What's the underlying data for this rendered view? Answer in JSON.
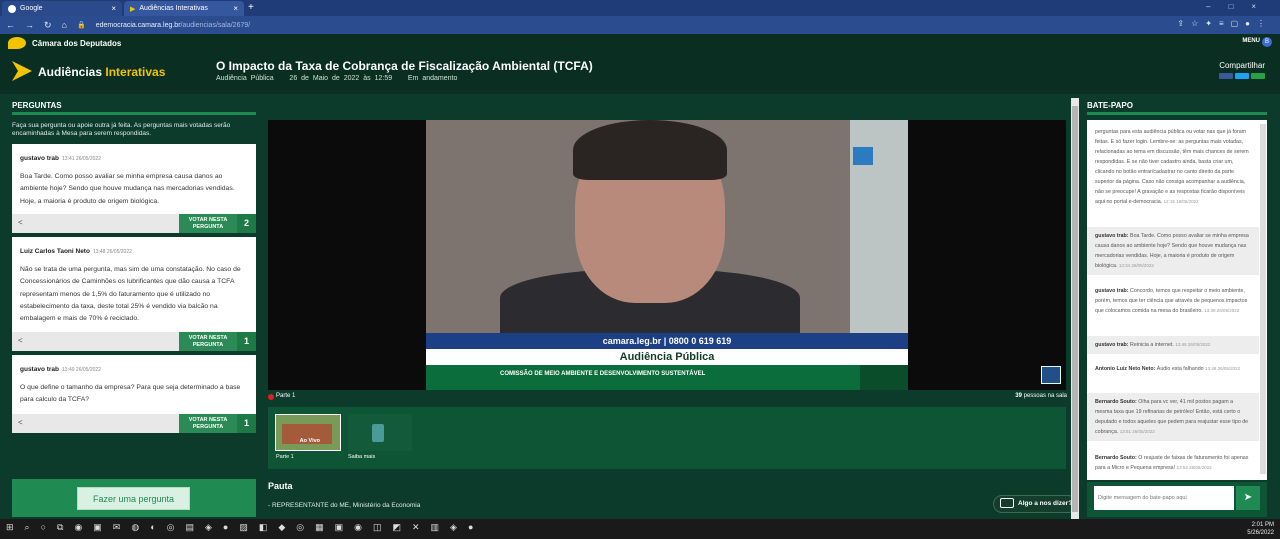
{
  "browser": {
    "tabs": [
      {
        "label": "Google"
      },
      {
        "label": "Audiências Interativas"
      }
    ],
    "url_host": "edemocracia.camara.leg.br",
    "url_path": "/audiencias/sala/2679/"
  },
  "camara": {
    "name": "Câmara dos Deputados",
    "menu": "MENU",
    "avatar_letter": "B"
  },
  "header": {
    "logo_white": "Audiências ",
    "logo_yellow": "Interativas",
    "title": "O Impacto da Taxa de Cobrança de Fiscalização Ambiental (TCFA)",
    "subtitle": "Audiência Pública    26 de Maio de 2022 às 12:59    Em andamento",
    "share": "Compartilhar"
  },
  "questions": {
    "heading": "PERGUNTAS",
    "intro": "Faça sua pergunta ou apoie outra já feita. As perguntas mais votadas serão encaminhadas à Mesa para serem respondidas.",
    "vote_label": "VOTAR NESTA PERGUNTA",
    "items": [
      {
        "author": "gustavo trab",
        "time": "13:41 26/05/2022",
        "text": "Boa Tarde. Como posso avaliar se minha empresa causa danos ao ambiente hoje? Sendo que houve mudança nas mercadorias vendidas. Hoje, a maioria é produto de origem biológica.",
        "votes": "2"
      },
      {
        "author": "Luiz Carlos Taoni Neto",
        "time": "13:48 26/05/2022",
        "text": "Não se trata de uma pergunta, mas sim de uma constatação. No caso de Concessionários de Caminhões os lubrificantes que dão causa a TCFA representam menos de 1,5% do faturamento que é utilizado no estabelecimento da taxa, deste total 25% é vendido via balcão na embalagem e mais de 70% é reciclado.",
        "votes": "1"
      },
      {
        "author": "gustavo trab",
        "time": "13:49 26/05/2022",
        "text": "O que define o tamanho da empresa? Para que seja determinado a base para calculo da TCFA?",
        "votes": "1"
      }
    ],
    "ask_button": "Fazer uma pergunta"
  },
  "video": {
    "banner_url": "camara.leg.br | 0800 0 619 619",
    "banner_title": "Audiência Pública",
    "banner_commission": "COMISSÃO DE MEIO AMBIENTE E DESENVOLVIMENTO SUSTENTÁVEL",
    "part_label": "Parte 1",
    "people_count": "39",
    "people_label": " pessoas na sala"
  },
  "thumbs": [
    {
      "label": "Parte 1",
      "badge": "Ao Vivo"
    },
    {
      "label": "Saiba mais"
    }
  ],
  "pauta": {
    "heading": "Pauta",
    "item": "- REPRESENTANTE do ME, Ministério da Economia"
  },
  "algo": "Algo a nos dizer?",
  "chat": {
    "heading": "BATE-PAPO",
    "messages": [
      {
        "author": "",
        "text": "perguntas para esta audiência pública ou votar nas que já foram feitas. E só fazer login. Lembre-se: as perguntas mais votadas, relacionadas ao tema em discussão, têm mais chances de serem respondidas. E se não tiver cadastro ainda, basta criar um, clicando no botão entrar/cadastrar no canto direito da parte superior da página. Caso não consiga acompanhar a audiência, não se preocupe! A gravação e as respostas ficarão disponíveis aqui no portal e-democracia.",
        "time": "12:15 18/05/2022"
      },
      {
        "author": "gustavo trab:",
        "text": " Boa Tarde. Como posso avaliar se minha empresa causa danos ao ambiente hoje? Sendo que houve mudança nas mercadorias vendidas. Hoje, a maioria é produto de origem biológica.",
        "time": "13:34 26/05/2022"
      },
      {
        "author": "gustavo trab:",
        "text": " Concordo, temos que respeitar o meio ambiente, porém, temos que ter ciência que através de pequenos impactos que colocamos comida na mesa do brasileiro.",
        "time": "13:39 26/05/2022"
      },
      {
        "author": "gustavo trab:",
        "text": " Reinicia a internet.",
        "time": "13:48 26/05/2022"
      },
      {
        "author": "Antonio Luiz Neto Neto:",
        "text": " Áudio esta falhando",
        "time": "13:48 26/05/2022"
      },
      {
        "author": "Bernardo Souto:",
        "text": " Olha para vc ver, 41 mil postos pagam a mesma taxa que 19 refinarias de petróleo! Então, está certo o deputado e todos aqueles que pedem para reajustar esse tipo de cobrança.",
        "time": "13:51 26/05/2022"
      },
      {
        "author": "Bernardo Souto:",
        "text": " O reajuste de faixas de faturamento foi apenas para a Micro e Pequena empresa!",
        "time": "13:52 26/05/2022"
      }
    ],
    "input_placeholder": "Digite mensagem do bate-papo aqui"
  },
  "taskbar": {
    "time": "2:01 PM",
    "date": "5/26/2022"
  },
  "colors": {
    "brand_green": "#1f8a52",
    "dark_green": "#0a2f22",
    "yellow": "#f2c400",
    "browser_blue": "#2b4d8f"
  }
}
